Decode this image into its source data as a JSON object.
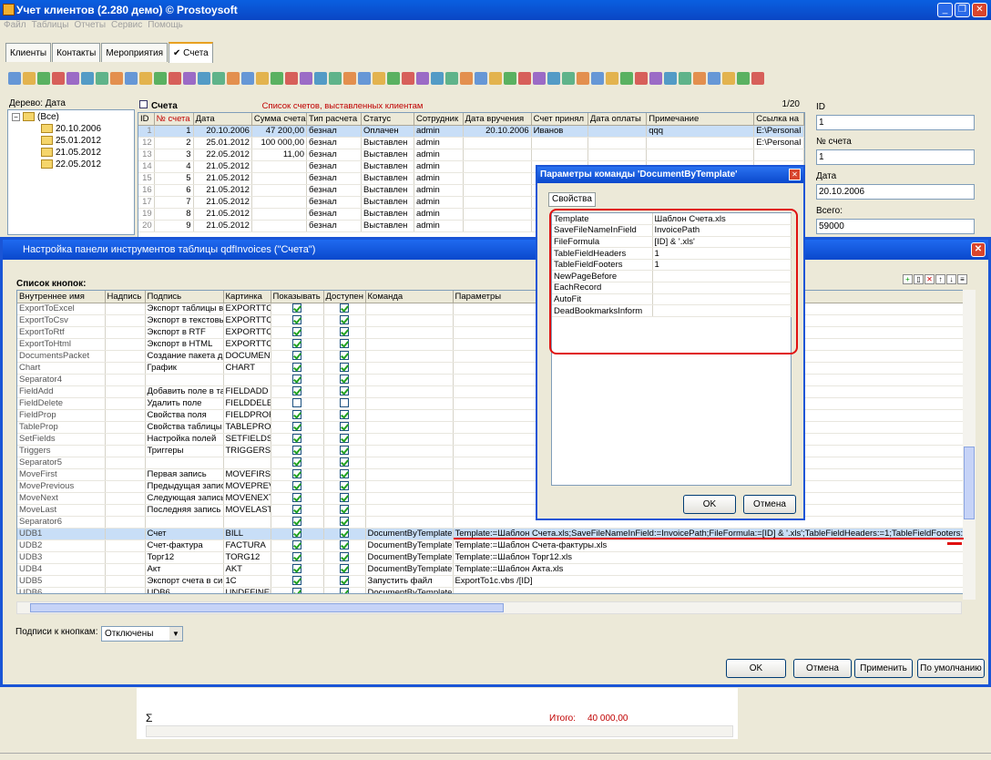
{
  "app": {
    "title": "Учет клиентов (2.280 демо) © Prostoysoft",
    "menu": [
      "Файл",
      "Таблицы",
      "Отчеты",
      "Сервис",
      "Помощь"
    ],
    "tabs": [
      "Клиенты",
      "Контакты",
      "Мероприятия",
      "✔ Счета"
    ]
  },
  "tree": {
    "label": "Дерево: Дата",
    "root": "(Все)",
    "items": [
      "20.10.2006",
      "25.01.2012",
      "21.05.2012",
      "22.05.2012"
    ]
  },
  "invoices": {
    "title": "Счета",
    "subtitle": "Список счетов, выставленных клиентам",
    "counter": "1/20",
    "columns": [
      "ID",
      "№ счета",
      "Дата",
      "Сумма счета",
      "Тип расчета",
      "Статус",
      "Сотрудник",
      "Дата вручения",
      "Счет принял",
      "Дата оплаты",
      "Примечание",
      "Ссылка на"
    ],
    "rows": [
      [
        "1",
        "1",
        "20.10.2006",
        "47 200,00",
        "безнал",
        "Оплачен",
        "admin",
        "20.10.2006",
        "Иванов",
        "",
        "qqq",
        "E:\\Personal"
      ],
      [
        "12",
        "2",
        "25.01.2012",
        "100 000,00",
        "безнал",
        "Выставлен",
        "admin",
        "",
        "",
        "",
        "",
        "E:\\Personal"
      ],
      [
        "13",
        "3",
        "22.05.2012",
        "11,00",
        "безнал",
        "Выставлен",
        "admin",
        "",
        "",
        "",
        "",
        ""
      ],
      [
        "14",
        "4",
        "21.05.2012",
        "",
        "безнал",
        "Выставлен",
        "admin",
        "",
        "",
        "",
        "",
        ""
      ],
      [
        "15",
        "5",
        "21.05.2012",
        "",
        "безнал",
        "Выставлен",
        "admin",
        "",
        "",
        "",
        "",
        ""
      ],
      [
        "16",
        "6",
        "21.05.2012",
        "",
        "безнал",
        "Выставлен",
        "admin",
        "",
        "",
        "",
        "",
        ""
      ],
      [
        "17",
        "7",
        "21.05.2012",
        "",
        "безнал",
        "Выставлен",
        "admin",
        "",
        "",
        "",
        "",
        ""
      ],
      [
        "19",
        "8",
        "21.05.2012",
        "",
        "безнал",
        "Выставлен",
        "admin",
        "",
        "",
        "",
        "",
        ""
      ],
      [
        "20",
        "9",
        "21.05.2012",
        "",
        "безнал",
        "Выставлен",
        "admin",
        "",
        "",
        "",
        "",
        ""
      ]
    ]
  },
  "record": {
    "id_label": "ID",
    "id": "1",
    "num_label": "№ счета",
    "num": "1",
    "date_label": "Дата",
    "date": "20.10.2006",
    "total_label": "Всего:",
    "total": "59000"
  },
  "dialog": {
    "title": "Настройка панели инструментов таблицы qdfInvoices (\"Счета\")",
    "list_label": "Список кнопок:",
    "columns": [
      "Внутреннее имя",
      "Надпись",
      "Подпись",
      "Картинка",
      "Показывать",
      "Доступен",
      "Команда",
      "Параметры"
    ],
    "rows": [
      [
        "ExportToExcel",
        "",
        "Экспорт таблицы в",
        "EXPORTTC",
        true,
        true,
        "",
        ""
      ],
      [
        "ExportToCsv",
        "",
        "Экспорт в текстовь",
        "EXPORTTC",
        true,
        true,
        "",
        ""
      ],
      [
        "ExportToRtf",
        "",
        "Экспорт в RTF",
        "EXPORTTC",
        true,
        true,
        "",
        ""
      ],
      [
        "ExportToHtml",
        "",
        "Экспорт в HTML",
        "EXPORTTC",
        true,
        true,
        "",
        ""
      ],
      [
        "DocumentsPacket",
        "",
        "Создание пакета д",
        "DOCUMENT",
        true,
        true,
        "",
        ""
      ],
      [
        "Chart",
        "",
        "График",
        "CHART",
        true,
        true,
        "",
        ""
      ],
      [
        "Separator4",
        "",
        "",
        "",
        true,
        true,
        "",
        ""
      ],
      [
        "FieldAdd",
        "",
        "Добавить поле в та",
        "FIELDADD",
        true,
        true,
        "",
        ""
      ],
      [
        "FieldDelete",
        "",
        "Удалить поле",
        "FIELDDELE",
        false,
        false,
        "",
        ""
      ],
      [
        "FieldProp",
        "",
        "Свойства поля",
        "FIELDPROF",
        true,
        true,
        "",
        ""
      ],
      [
        "TableProp",
        "",
        "Свойства таблицы",
        "TABLEPRO",
        true,
        true,
        "",
        ""
      ],
      [
        "SetFields",
        "",
        "Настройка полей",
        "SETFIELDS",
        true,
        true,
        "",
        ""
      ],
      [
        "Triggers",
        "",
        "Триггеры",
        "TRIGGERS",
        true,
        true,
        "",
        ""
      ],
      [
        "Separator5",
        "",
        "",
        "",
        true,
        true,
        "",
        ""
      ],
      [
        "MoveFirst",
        "",
        "Первая запись",
        "MOVEFIRS",
        true,
        true,
        "",
        ""
      ],
      [
        "MovePrevious",
        "",
        "Предыдущая запис",
        "MOVEPREV",
        true,
        true,
        "",
        ""
      ],
      [
        "MoveNext",
        "",
        "Следующая запись",
        "MOVENEXT",
        true,
        true,
        "",
        ""
      ],
      [
        "MoveLast",
        "",
        "Последняя запись",
        "MOVELAST",
        true,
        true,
        "",
        ""
      ],
      [
        "Separator6",
        "",
        "",
        "",
        true,
        true,
        "",
        ""
      ],
      [
        "UDB1",
        "",
        "Счет",
        "BILL",
        true,
        true,
        "DocumentByTemplate",
        "Template:=Шаблон Счета.xls;SaveFileNameInField:=InvoicePath;FileFormula:=[ID] & '.xls';TableFieldHeaders:=1;TableFieldFooters:=1"
      ],
      [
        "UDB2",
        "",
        "Счет-фактура",
        "FACTURA",
        true,
        true,
        "DocumentByTemplate",
        "Template:=Шаблон Счета-фактуры.xls"
      ],
      [
        "UDB3",
        "",
        "Торг12",
        "TORG12",
        true,
        true,
        "DocumentByTemplate",
        "Template:=Шаблон Торг12.xls"
      ],
      [
        "UDB4",
        "",
        "Акт",
        "AKT",
        true,
        true,
        "DocumentByTemplate",
        "Template:=Шаблон Акта.xls"
      ],
      [
        "UDB5",
        "",
        "Экспорт счета в си",
        "1C",
        true,
        true,
        "Запустить файл",
        "ExportTo1c.vbs /[ID]"
      ],
      [
        "UDB6",
        "",
        "UDB6",
        "UNDEFINEI",
        true,
        true,
        "DocumentByTemplate",
        ""
      ]
    ],
    "captions_label": "Подписи к кнопкам:",
    "captions_value": "Отключены",
    "ok": "OK",
    "cancel": "Отмена",
    "apply": "Применить",
    "default": "По умолчанию"
  },
  "props": {
    "title": "Параметры команды 'DocumentByTemplate'",
    "tab": "Свойства",
    "rows": [
      [
        "Template",
        "Шаблон Счета.xls"
      ],
      [
        "SaveFileNameInField",
        "InvoicePath"
      ],
      [
        "FileFormula",
        "[ID] & '.xls'"
      ],
      [
        "TableFieldHeaders",
        "1"
      ],
      [
        "TableFieldFooters",
        "1"
      ],
      [
        "NewPageBefore",
        ""
      ],
      [
        "EachRecord",
        ""
      ],
      [
        "AutoFit",
        ""
      ],
      [
        "DeadBookmarksInform",
        ""
      ]
    ],
    "ok": "OK",
    "cancel": "Отмена"
  },
  "footer": {
    "sigma": "Σ",
    "total_label": "Итого:",
    "total": "40 000,00"
  },
  "colors": {
    "accent": "#0a46c4",
    "highlight": "#e01010"
  }
}
